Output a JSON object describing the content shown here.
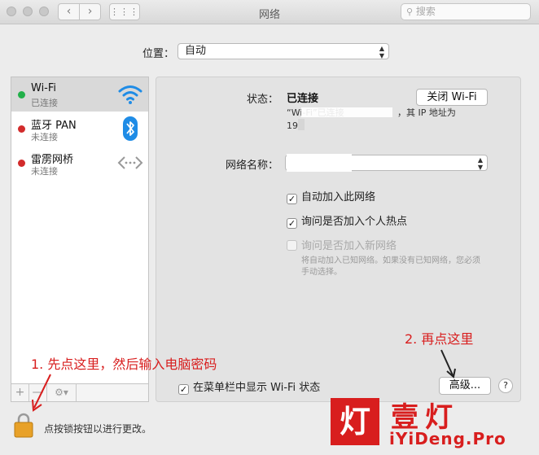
{
  "window": {
    "title": "网络",
    "search_placeholder": "搜索",
    "grid_glyph": "⋮⋮⋮"
  },
  "location": {
    "label": "位置：",
    "value": "自动"
  },
  "services": [
    {
      "name": "Wi-Fi",
      "status": "已连接",
      "dot_color": "#22b04a",
      "icon": "wifi-icon",
      "selected": true
    },
    {
      "name": "蓝牙 PAN",
      "status": "未连接",
      "dot_color": "#d22b2b",
      "icon": "bluetooth-icon",
      "selected": false
    },
    {
      "name": "雷雳网桥",
      "status": "未连接",
      "dot_color": "#d22b2b",
      "icon": "thunderbolt-bridge-icon",
      "selected": false
    }
  ],
  "toolbar": {
    "add": "+",
    "remove": "—",
    "gear": "⚙▾"
  },
  "status": {
    "label": "状态：",
    "value": "已连接",
    "turn_off_button": "关闭 Wi-Fi",
    "desc_line1": "“Wi-Fi”已连接",
    "desc_line1_tail": "，其 IP 地址为",
    "desc_line2": "19"
  },
  "network_name": {
    "label": "网络名称：",
    "value": ""
  },
  "options": [
    {
      "label": "自动加入此网络",
      "checked": true,
      "enabled": true
    },
    {
      "label": "询问是否加入个人热点",
      "checked": true,
      "enabled": true
    },
    {
      "label": "询问是否加入新网络",
      "checked": false,
      "enabled": false
    }
  ],
  "options_note": {
    "line1": "将自动加入已知网络。如果没有已知网络，您必须",
    "line2": "手动选择。"
  },
  "menubar_option": {
    "label": "在菜单栏中显示 Wi-Fi 状态",
    "checked": true
  },
  "advanced_button": "高级...",
  "help": "?",
  "lock_text": "点按锁按钮以进行更改。",
  "annotations": {
    "step1": "1. 先点这里，然后输入电脑密码",
    "step2": "2. 再点这里"
  },
  "watermark": {
    "badge": "灯",
    "cn": "壹灯",
    "url": "iYiDeng.Pro"
  },
  "colors": {
    "annotation": "#d81e1e",
    "wifi_blue": "#1f8ce6",
    "lock_gold": "#e8a128"
  }
}
